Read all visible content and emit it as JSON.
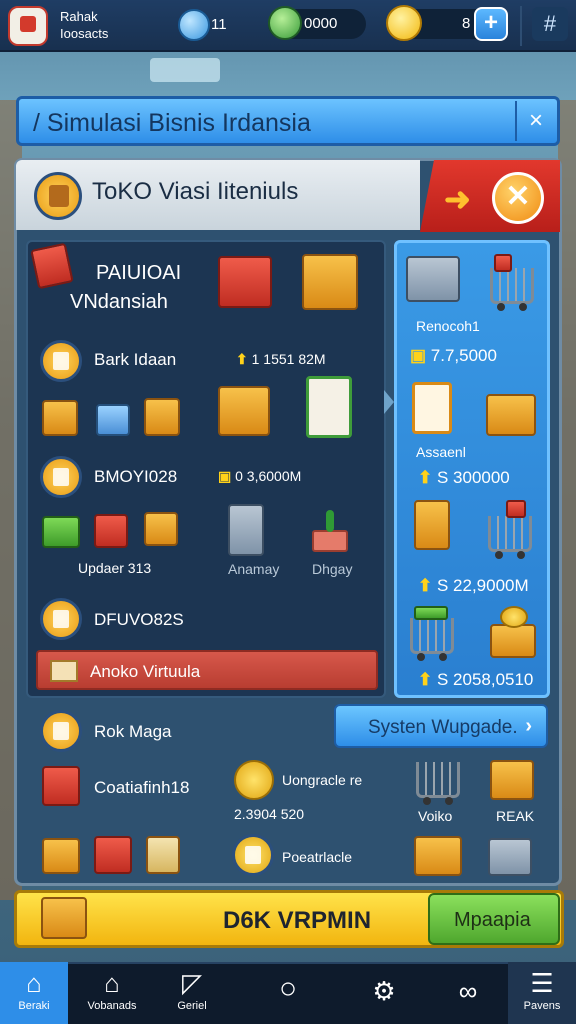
{
  "topbar": {
    "profile_name_line1": "Rahak",
    "profile_name_line2": "Ioosacts",
    "gems": "11",
    "cash": "0000",
    "coins": "8",
    "plus": "+",
    "menu_icon": "#"
  },
  "title": "/ Simulasi Bisnis Irdansia",
  "title_close": "×",
  "store": {
    "title": "ToKO Viasi Iiteniuls",
    "arrow": "➜",
    "close": "✕"
  },
  "left": {
    "header_line1": "PAIUIOAI",
    "header_line2": "VNdansiah",
    "bank_label": "Bark Idaan",
    "bank_value": "1 1551 82M",
    "mode_label": "BMOYI028",
    "mode_value": "0 3,6000M",
    "update_label": "Updaer 313",
    "item_label_1": "Anamay",
    "item_label_2": "Dhgay",
    "dev_label": "DFUVO82S",
    "banner": "Anoko Virtuula"
  },
  "right": {
    "label_1": "Renocoh1",
    "value_1": "7.7,5000",
    "label_2": "Assaenl",
    "value_2": "S 300000",
    "value_3": "S 22,9000M",
    "value_4": "S 2058,0510"
  },
  "bottom_section": {
    "rok_label": "Rok Maga",
    "upgrade_button": "Systen Wupgade.",
    "upgrade_arrow": "›",
    "coin_label": "Coatiafinh18",
    "upgrade_text": "Uongracle re",
    "money_value": "2.3904 520",
    "predict_label": "Poeatrlacle",
    "cart_label_1": "Voiko",
    "cart_label_2": "REAK"
  },
  "yellow_bar": {
    "text": "D6K VRPMIN",
    "button": "Mpaapia"
  },
  "nav": [
    {
      "label": "Beraki",
      "icon": "home-icon"
    },
    {
      "label": "Vobanads",
      "icon": "store-icon"
    },
    {
      "label": "Geriel",
      "icon": "map-icon"
    },
    {
      "label": "",
      "icon": "circle-icon"
    },
    {
      "label": "",
      "icon": "gear-icon"
    },
    {
      "label": "",
      "icon": "link-icon"
    },
    {
      "label": "Pavens",
      "icon": "menu-icon"
    }
  ],
  "colors": {
    "accent_blue": "#2e8ee8",
    "accent_yellow": "#f2b50f",
    "accent_green": "#4fa72e",
    "accent_red": "#c02d22"
  }
}
